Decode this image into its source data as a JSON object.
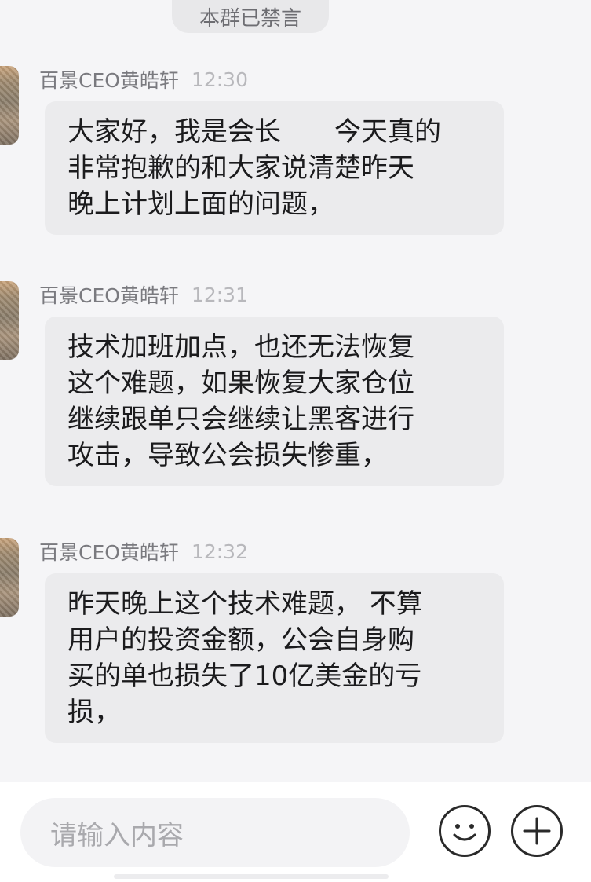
{
  "notice": "本群已禁言",
  "messages": [
    {
      "sender": "百景CEO黄皓轩",
      "time": "12:30",
      "lines": [
        "大家好，我是会长　　今天真的",
        "非常抱歉的和大家说清楚昨天",
        "晚上计划上面的问题，"
      ]
    },
    {
      "sender": "百景CEO黄皓轩",
      "time": "12:31",
      "lines": [
        "技术加班加点，也还无法恢复",
        "这个难题，如果恢复大家仓位",
        "继续跟单只会继续让黑客进行",
        "攻击，导致公会损失惨重，"
      ]
    },
    {
      "sender": "百景CEO黄皓轩",
      "time": "12:32",
      "lines": [
        "昨天晚上这个技术难题， 不算",
        "用户的投资金额，公会自身购",
        "买的单也损失了10亿美金的亏",
        "损，"
      ]
    }
  ],
  "input": {
    "placeholder": "请输入内容"
  },
  "icons": {
    "emoji": "emoji-smile-icon",
    "add": "plus-icon"
  }
}
